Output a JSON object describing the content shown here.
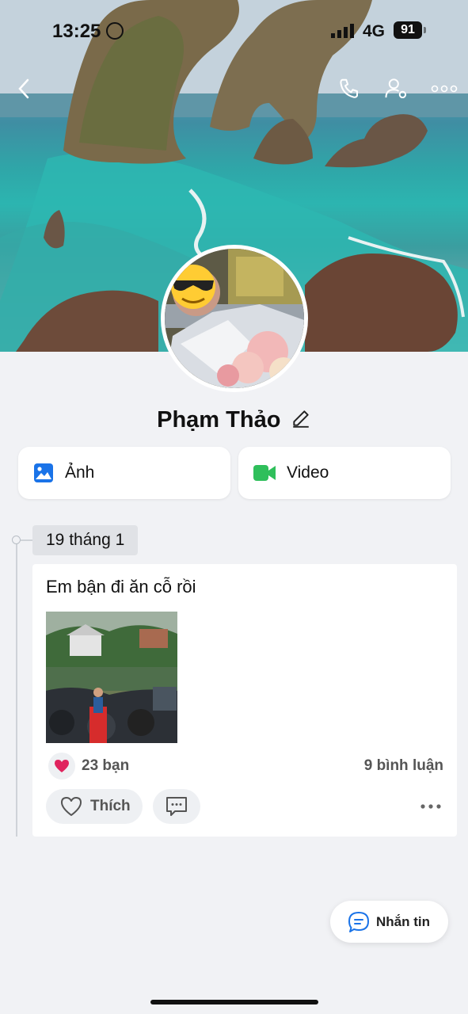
{
  "status_bar": {
    "time": "13:25",
    "network": "4G",
    "battery": "91"
  },
  "profile": {
    "name": "Phạm Thảo"
  },
  "actions": {
    "photos_label": "Ảnh",
    "video_label": "Video"
  },
  "timeline": {
    "date": "19 tháng 1",
    "post": {
      "text": "Em bận đi ăn cỗ rồi",
      "reactions": "23 bạn",
      "comments": "9 bình luận",
      "like_label": "Thích"
    }
  },
  "message_button": {
    "label": "Nhắn tin"
  },
  "colors": {
    "accent_blue": "#1a73e8",
    "video_green": "#2fbf5b",
    "heart_red": "#e0245e"
  }
}
